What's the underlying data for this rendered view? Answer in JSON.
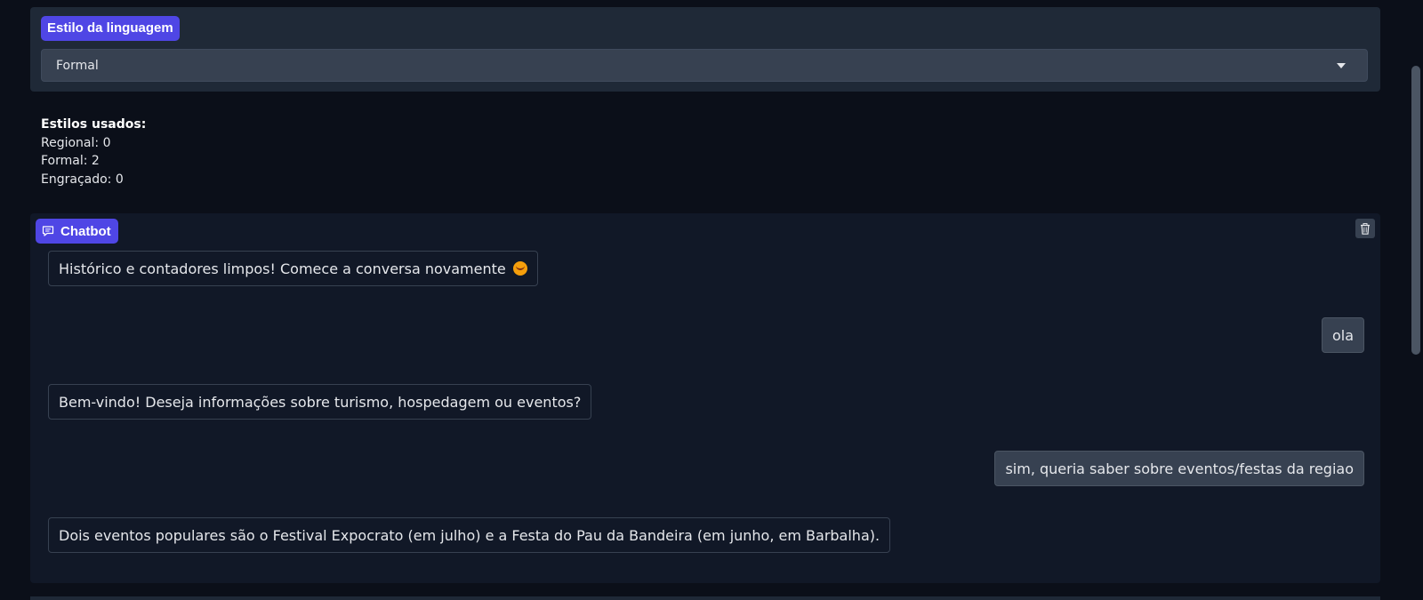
{
  "style_selector": {
    "label": "Estilo da linguagem",
    "selected_value": "Formal"
  },
  "counters": {
    "heading": "Estilos usados:",
    "lines": [
      "Regional: 0",
      "Formal: 2",
      "Engraçado: 0"
    ]
  },
  "chatbot": {
    "label": "Chatbot",
    "messages": [
      {
        "role": "bot",
        "text": "Histórico e contadores limpos! Comece a conversa novamente",
        "icon": "smiling-face-emoji"
      },
      {
        "role": "user",
        "text": "ola"
      },
      {
        "role": "bot",
        "text": "Bem-vindo! Deseja informações sobre turismo, hospedagem ou eventos?"
      },
      {
        "role": "user",
        "text": "sim, queria saber sobre eventos/festas da regiao"
      },
      {
        "role": "bot",
        "text": "Dois eventos populares são o Festival Expocrato (em julho) e a Festa do Pau da Bandeira (em junho, em Barbalha)."
      }
    ]
  },
  "colors": {
    "accent": "#4f46e5",
    "background": "#0b0f19",
    "panel": "#1f2937",
    "chat_panel": "#111827"
  }
}
